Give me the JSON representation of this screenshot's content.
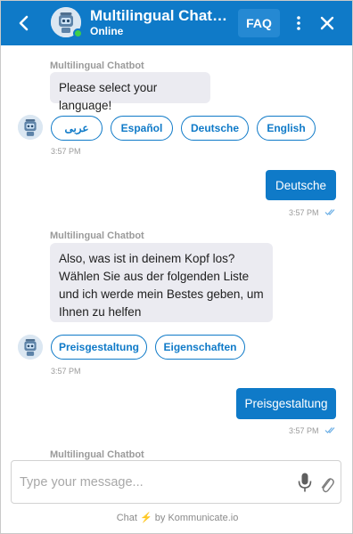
{
  "header": {
    "title": "Multilingual Chatbot",
    "status": "Online",
    "faq_label": "FAQ"
  },
  "messages": [
    {
      "bot_name": "Multilingual Chatbot",
      "text": "Please select your language!",
      "chips": [
        "عربى",
        "Español",
        "Deutsche",
        "English"
      ],
      "time": "3:57 PM"
    },
    {
      "user_text": "Deutsche",
      "time": "3:57 PM"
    },
    {
      "bot_name": "Multilingual Chatbot",
      "text": "Also, was ist in deinem Kopf los? Wählen Sie aus der folgenden Liste und ich werde mein Bestes geben, um Ihnen zu helfen",
      "chips": [
        "Preisgestaltung",
        "Eigenschaften"
      ],
      "time": "3:57 PM"
    },
    {
      "user_text": "Preisgestaltung",
      "time": "3:57 PM"
    },
    {
      "bot_name": "Multilingual Chatbot"
    }
  ],
  "composer": {
    "placeholder": "Type your message..."
  },
  "footer": {
    "prefix": "Chat",
    "suffix": "by Kommunicate.io"
  },
  "colors": {
    "brand": "#0f7ac8",
    "online": "#3ecf4a",
    "bot_bubble": "#ebebf1"
  },
  "icons": [
    "back-arrow-icon",
    "bot-avatar-icon",
    "more-vertical-icon",
    "close-icon",
    "read-ticks-icon",
    "microphone-icon",
    "paperclip-icon",
    "lightning-icon"
  ]
}
